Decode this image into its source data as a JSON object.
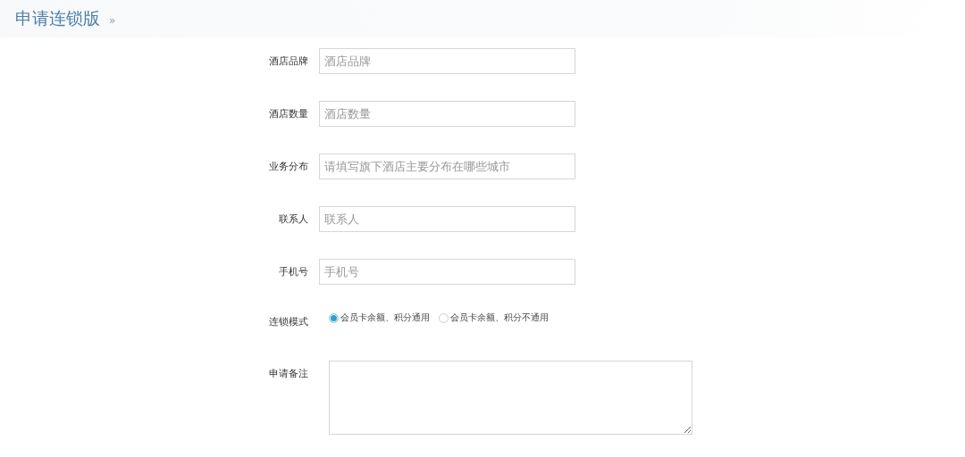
{
  "header": {
    "title": "申请连锁版",
    "chevron": "»"
  },
  "fields": [
    {
      "label": "酒店品牌",
      "placeholder": "酒店品牌"
    },
    {
      "label": "酒店数量",
      "placeholder": "酒店数量"
    },
    {
      "label": "业务分布",
      "placeholder": "请填写旗下酒店主要分布在哪些城市"
    },
    {
      "label": "联系人",
      "placeholder": "联系人"
    },
    {
      "label": "手机号",
      "placeholder": "手机号"
    }
  ],
  "chain_mode": {
    "label": "连锁模式",
    "options": [
      {
        "label": "会员卡余额、积分通用",
        "selected": true
      },
      {
        "label": "会员卡余额、积分不通用",
        "selected": false
      }
    ]
  },
  "remarks": {
    "label": "申请备注"
  }
}
